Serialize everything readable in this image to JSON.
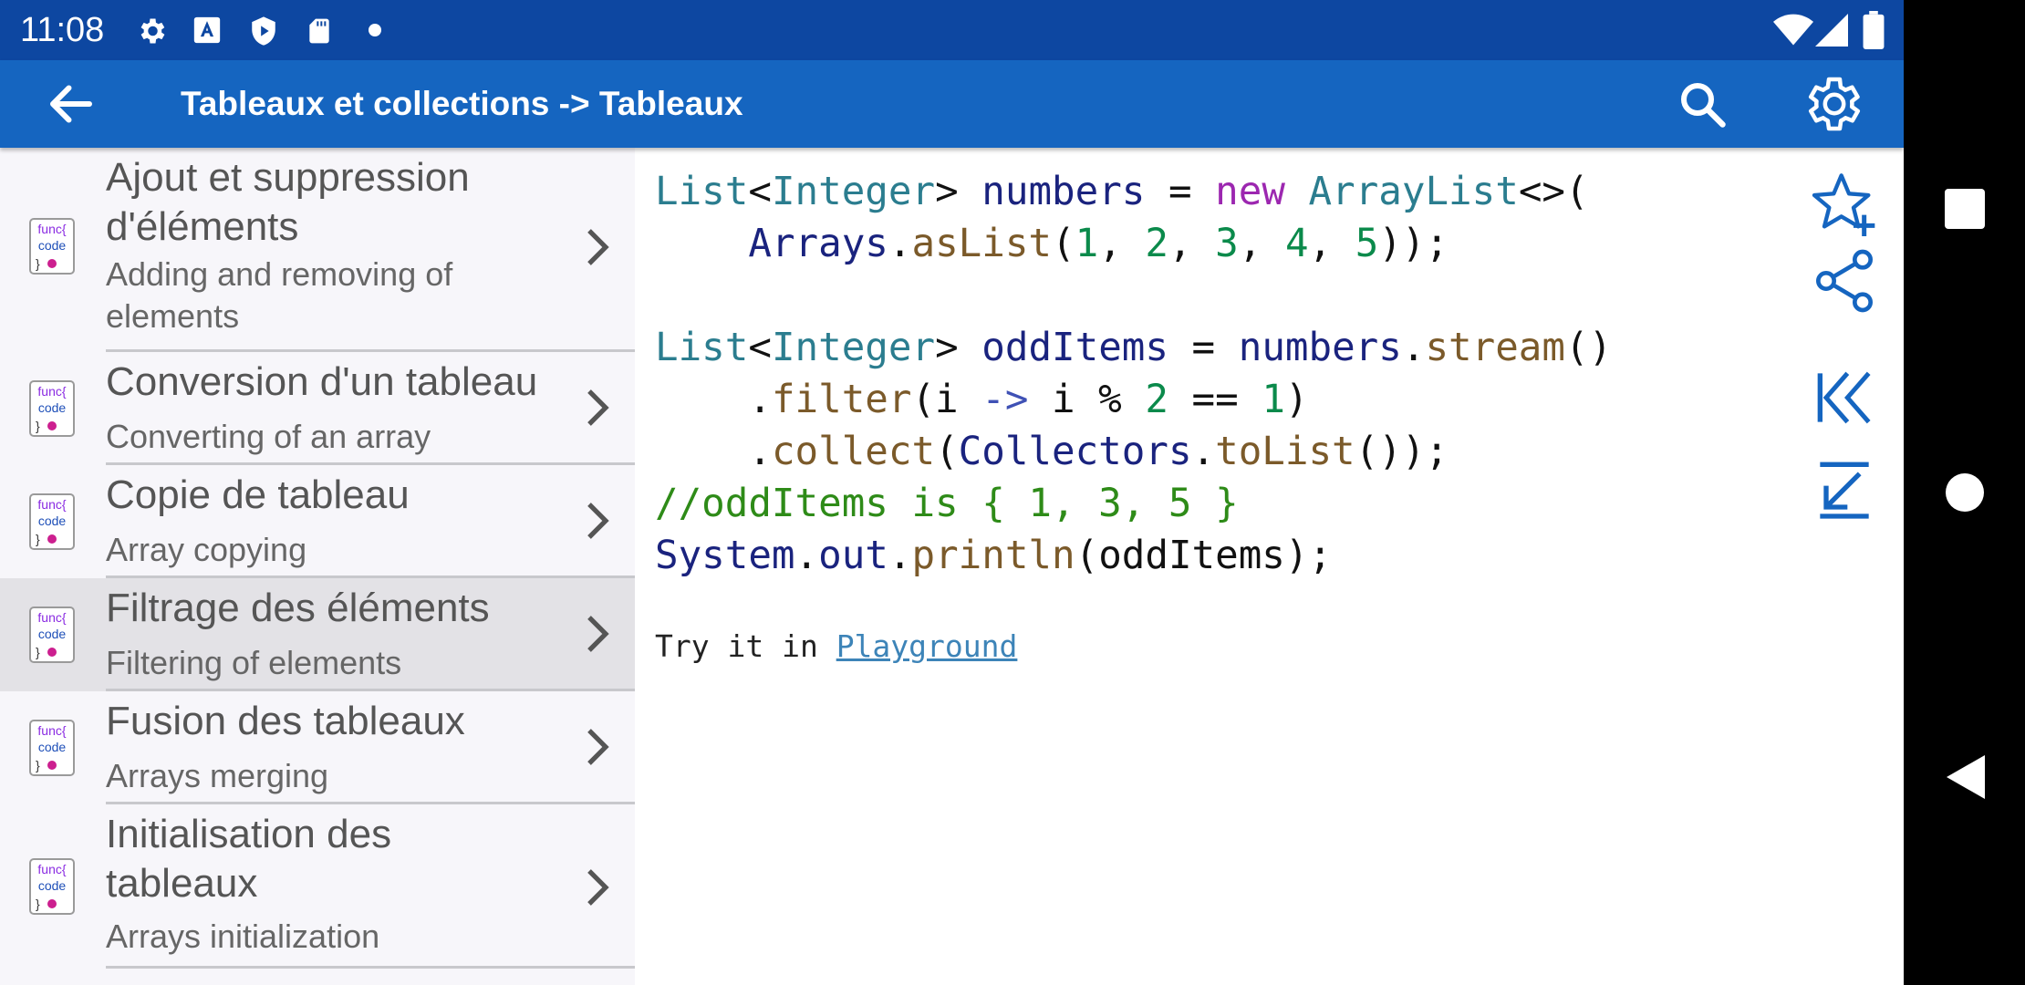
{
  "status_bar": {
    "time": "11:08",
    "icons": [
      "gear-icon",
      "text-a-icon",
      "shield-icon",
      "sd-card-icon",
      "dot-icon"
    ],
    "right_icons": [
      "wifi-icon",
      "signal-icon",
      "battery-icon"
    ]
  },
  "app_bar": {
    "title": "Tableaux et collections -> Tableaux",
    "icons": [
      "back-arrow-icon",
      "search-icon",
      "settings-gear-icon"
    ]
  },
  "list": {
    "item_icon": {
      "line1": "func{",
      "line2": "code",
      "line3": "}"
    },
    "items": [
      {
        "title_lines": [
          "Ajout et suppression",
          "d'éléments"
        ],
        "subtitle_lines": [
          "Adding and removing of",
          "elements"
        ],
        "selected": false
      },
      {
        "title_lines": [
          "Conversion d'un tableau"
        ],
        "subtitle_lines": [
          "Converting of an array"
        ],
        "selected": false
      },
      {
        "title_lines": [
          "Copie de tableau"
        ],
        "subtitle_lines": [
          "Array copying"
        ],
        "selected": false
      },
      {
        "title_lines": [
          "Filtrage des éléments"
        ],
        "subtitle_lines": [
          "Filtering of elements"
        ],
        "selected": true
      },
      {
        "title_lines": [
          "Fusion des tableaux"
        ],
        "subtitle_lines": [
          "Arrays merging"
        ],
        "selected": false
      },
      {
        "title_lines": [
          "Initialisation des",
          "tableaux"
        ],
        "subtitle_lines": [
          "Arrays initialization"
        ],
        "selected": false
      }
    ]
  },
  "code": {
    "lines": [
      "List<Integer> numbers = new ArrayList<>(",
      "    Arrays.asList(1, 2, 3, 4, 5));",
      "",
      "List<Integer> oddItems = numbers.stream()",
      "    .filter(i -> i % 2 == 1)",
      "    .collect(Collectors.toList());",
      "//oddItems is { 1, 3, 5 }",
      "System.out.println(oddItems);"
    ],
    "try_prefix": "Try it in ",
    "try_link": "Playground"
  },
  "side_tools": {
    "icons": [
      "star-plus-icon",
      "share-icon",
      "skip-to-start-icon",
      "arrow-down-left-icon"
    ]
  },
  "nav_bar": {
    "icons": [
      "recents-square-icon",
      "home-circle-icon",
      "back-triangle-icon"
    ]
  },
  "colors": {
    "status_bar": "#0d47a1",
    "app_bar": "#1565c0",
    "tool_icon": "#1565c0",
    "type": "#2b7d8f",
    "keyword": "#9c27b0",
    "method": "#7b5a2a",
    "number": "#0b8a4b",
    "comment": "#2e8b18",
    "link": "#3d84b8"
  }
}
